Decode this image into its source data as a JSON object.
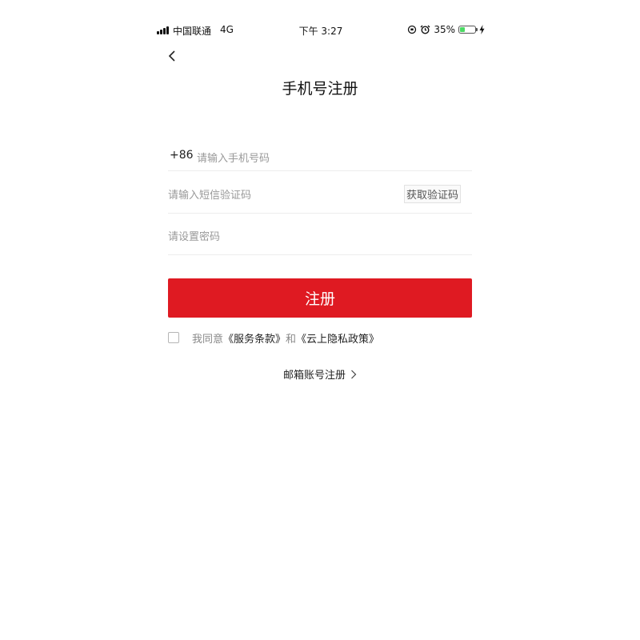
{
  "status_bar": {
    "carrier": "中国联通",
    "network": "4G",
    "time": "下午 3:27",
    "battery_percent": "35%",
    "battery_level": 0.35,
    "battery_color": "#4cd964"
  },
  "header": {
    "back_icon": "chevron-left-icon",
    "title": "手机号注册"
  },
  "form": {
    "country_code": "+86",
    "phone_placeholder": "请输入手机号码",
    "sms_placeholder": "请输入短信验证码",
    "get_code_label": "获取验证码",
    "password_placeholder": "请设置密码"
  },
  "register_button": {
    "label": "注册",
    "color": "#df1a22"
  },
  "agreement": {
    "checked": false,
    "prefix": "我同意",
    "terms": "《服务条款》",
    "and": "和",
    "privacy": "《云上隐私政策》"
  },
  "email_register": {
    "label": "邮箱账号注册",
    "icon": "chevron-right-icon"
  }
}
